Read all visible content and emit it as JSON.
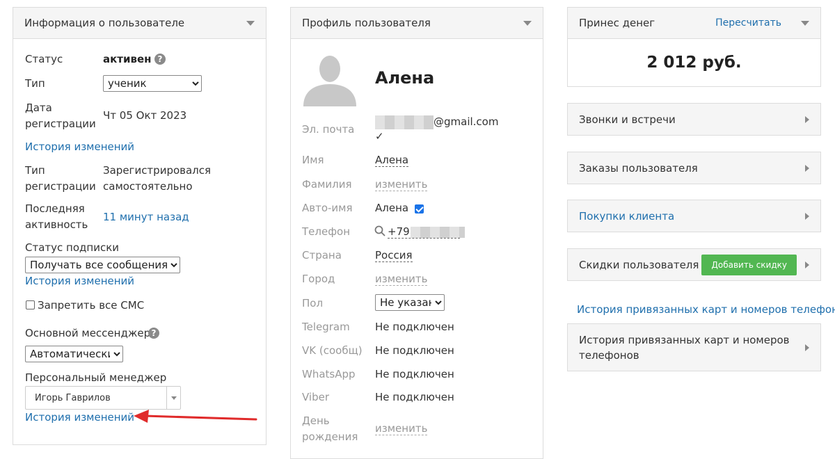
{
  "user_info": {
    "title": "Информация о пользователе",
    "status_label": "Статус",
    "status_value": "активен",
    "type_label": "Тип",
    "type_value": "ученик",
    "reg_date_label_1": "Дата",
    "reg_date_label_2": "регистрации",
    "reg_date_value": "Чт 05 Окт 2023",
    "history_link_1": "История изменений",
    "reg_type_label_1": "Тип",
    "reg_type_label_2": "регистрации",
    "reg_type_value_1": "Зарегистрировался",
    "reg_type_value_2": "самостоятельно",
    "last_activity_label_1": "Последняя",
    "last_activity_label_2": "активность",
    "last_activity_value": "11 минут назад",
    "subscription_label": "Статус подписки",
    "subscription_value": "Получать все сообщения",
    "history_link_2": "История изменений",
    "sms_label": "Запретить все СМС",
    "messenger_label": "Основной мессенджер",
    "messenger_value": "Автоматически",
    "manager_label": "Персональный менеджер",
    "manager_value": "Игорь Гаврилов",
    "history_link_3": "История изменений"
  },
  "profile": {
    "title": "Профиль пользователя",
    "name_display": "Алена",
    "email_label": "Эл. почта",
    "email_domain": "@gmail.com",
    "email_verified_mark": "✓",
    "first_name_label": "Имя",
    "first_name_value": "Алена",
    "last_name_label": "Фамилия",
    "last_name_value": "изменить",
    "auto_name_label": "Авто-имя",
    "auto_name_value": "Алена",
    "phone_label": "Телефон",
    "phone_prefix": "+79",
    "country_label": "Страна",
    "country_value": "Россия",
    "city_label": "Город",
    "city_value": "изменить",
    "gender_label": "Пол",
    "gender_value": "Не указан",
    "telegram_label": "Telegram",
    "telegram_value": "Не подключен",
    "vk_label": "VK (сообщ)",
    "vk_value": "Не подключен",
    "whatsapp_label": "WhatsApp",
    "whatsapp_value": "Не подключен",
    "viber_label": "Viber",
    "viber_value": "Не подключен",
    "birthday_label_1": "День",
    "birthday_label_2": "рождения",
    "birthday_value": "изменить"
  },
  "money": {
    "title": "Принес денег",
    "recalc_link": "Пересчитать",
    "amount": "2 012 руб."
  },
  "sections": {
    "calls": "Звонки и встречи",
    "orders": "Заказы пользователя",
    "purchases": "Покупки клиента",
    "discounts": "Скидки пользователя",
    "add_discount": "Добавить скидку",
    "cards_history_link": "История привязанных карт и номеров телефонов",
    "cards_history_title_1": "История привязанных карт и номеров",
    "cards_history_title_2": "телефонов"
  },
  "colors": {
    "link": "#1f6fad",
    "accent_green": "#52b752",
    "annotation_arrow": "#e02b2b"
  }
}
